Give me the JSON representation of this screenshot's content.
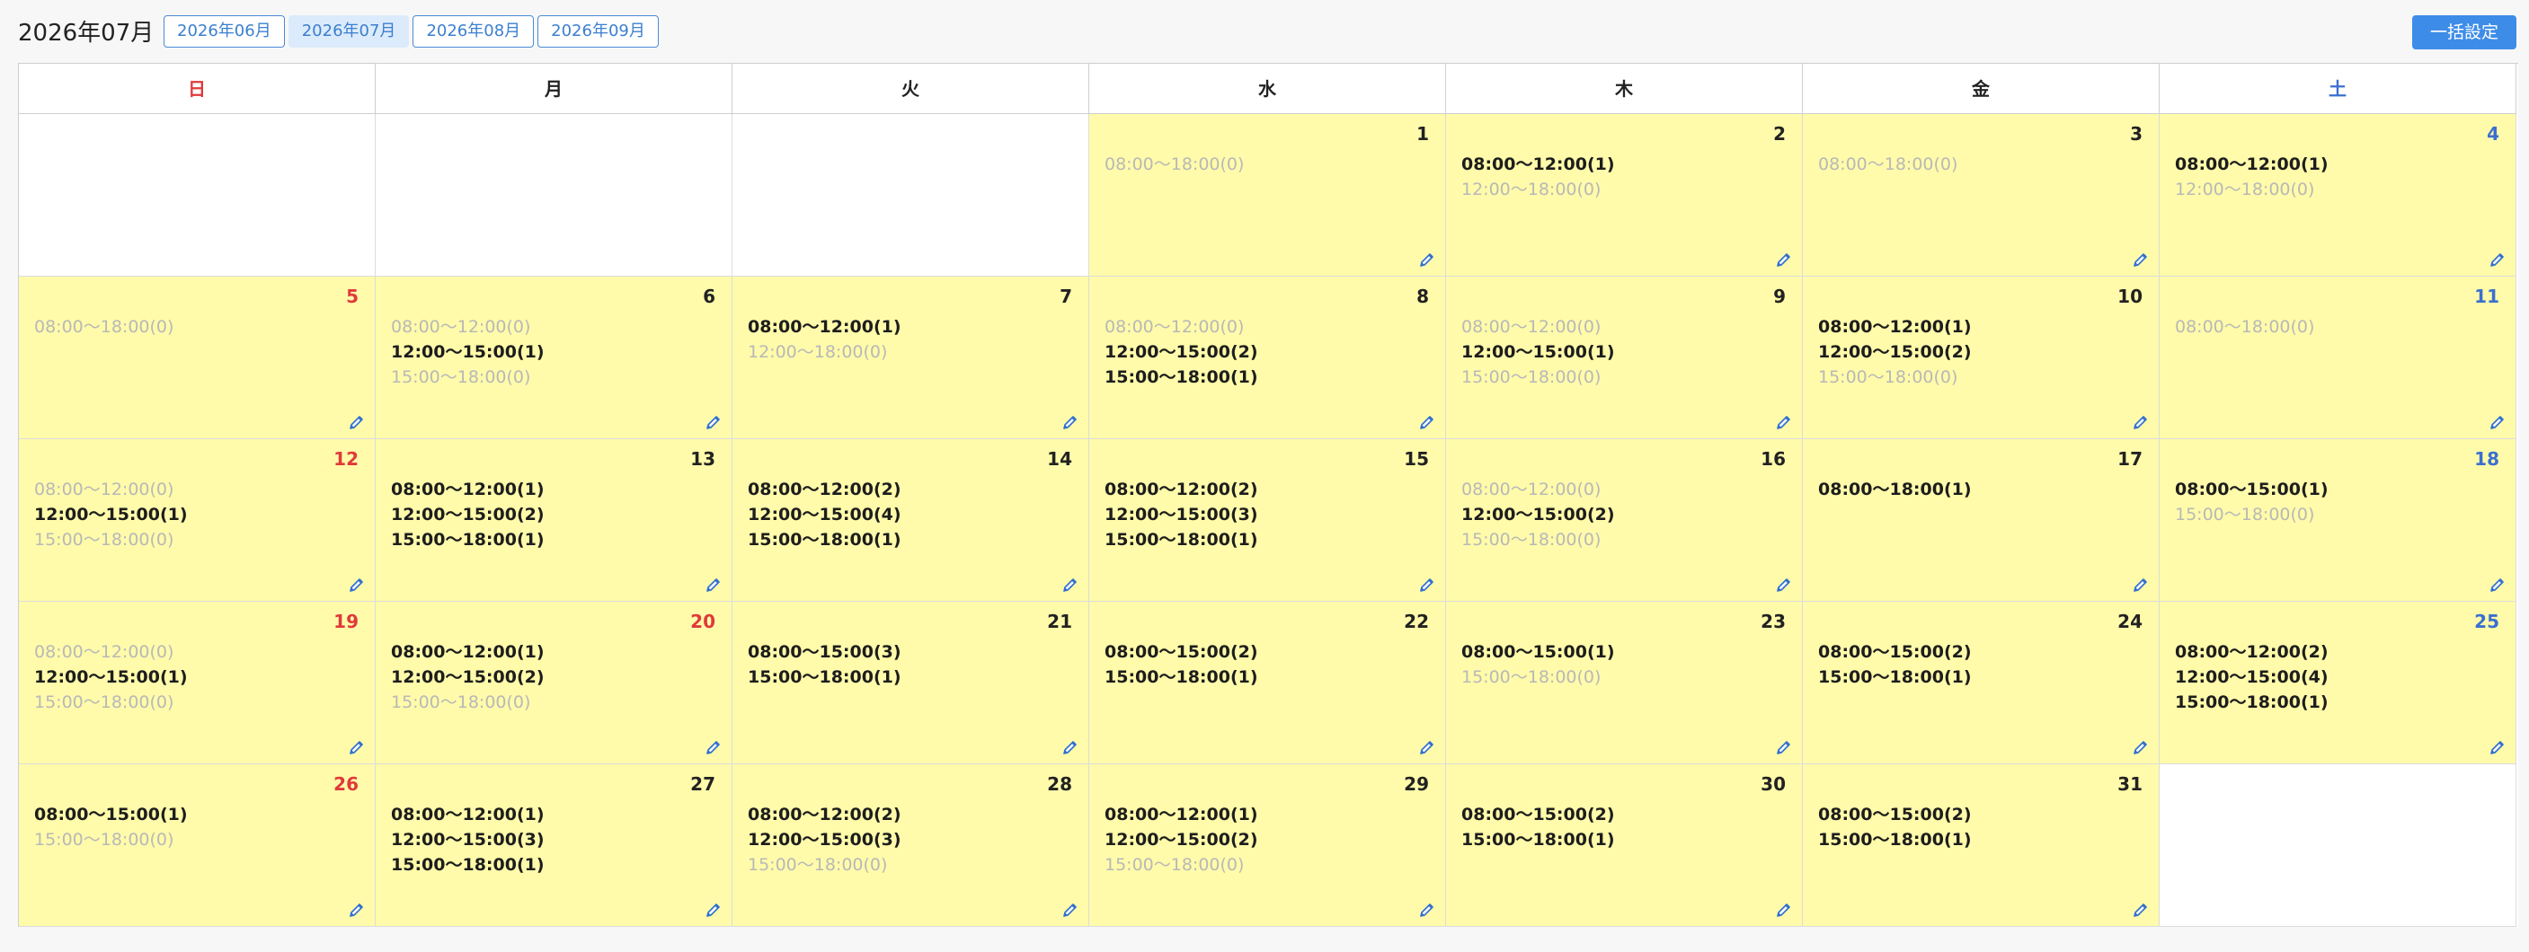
{
  "header": {
    "title": "2026年07月",
    "tabs": [
      {
        "label": "2026年06月",
        "active": false
      },
      {
        "label": "2026年07月",
        "active": true
      },
      {
        "label": "2026年08月",
        "active": false
      },
      {
        "label": "2026年09月",
        "active": false
      }
    ],
    "bulk_button": "一括設定"
  },
  "calendar": {
    "weekdays": [
      "日",
      "月",
      "火",
      "水",
      "木",
      "金",
      "土"
    ],
    "weeks": [
      [
        null,
        null,
        null,
        {
          "day": "1",
          "slots": [
            {
              "text": "08:00〜18:00(0)",
              "booked": false
            }
          ]
        },
        {
          "day": "2",
          "slots": [
            {
              "text": "08:00〜12:00(1)",
              "booked": true
            },
            {
              "text": "12:00〜18:00(0)",
              "booked": false
            }
          ]
        },
        {
          "day": "3",
          "slots": [
            {
              "text": "08:00〜18:00(0)",
              "booked": false
            }
          ]
        },
        {
          "day": "4",
          "slots": [
            {
              "text": "08:00〜12:00(1)",
              "booked": true
            },
            {
              "text": "12:00〜18:00(0)",
              "booked": false
            }
          ]
        }
      ],
      [
        {
          "day": "5",
          "slots": [
            {
              "text": "08:00〜18:00(0)",
              "booked": false
            }
          ]
        },
        {
          "day": "6",
          "slots": [
            {
              "text": "08:00〜12:00(0)",
              "booked": false
            },
            {
              "text": "12:00〜15:00(1)",
              "booked": true
            },
            {
              "text": "15:00〜18:00(0)",
              "booked": false
            }
          ]
        },
        {
          "day": "7",
          "slots": [
            {
              "text": "08:00〜12:00(1)",
              "booked": true
            },
            {
              "text": "12:00〜18:00(0)",
              "booked": false
            }
          ]
        },
        {
          "day": "8",
          "slots": [
            {
              "text": "08:00〜12:00(0)",
              "booked": false
            },
            {
              "text": "12:00〜15:00(2)",
              "booked": true
            },
            {
              "text": "15:00〜18:00(1)",
              "booked": true
            }
          ]
        },
        {
          "day": "9",
          "slots": [
            {
              "text": "08:00〜12:00(0)",
              "booked": false
            },
            {
              "text": "12:00〜15:00(1)",
              "booked": true
            },
            {
              "text": "15:00〜18:00(0)",
              "booked": false
            }
          ]
        },
        {
          "day": "10",
          "slots": [
            {
              "text": "08:00〜12:00(1)",
              "booked": true
            },
            {
              "text": "12:00〜15:00(2)",
              "booked": true
            },
            {
              "text": "15:00〜18:00(0)",
              "booked": false
            }
          ]
        },
        {
          "day": "11",
          "slots": [
            {
              "text": "08:00〜18:00(0)",
              "booked": false
            }
          ]
        }
      ],
      [
        {
          "day": "12",
          "slots": [
            {
              "text": "08:00〜12:00(0)",
              "booked": false
            },
            {
              "text": "12:00〜15:00(1)",
              "booked": true
            },
            {
              "text": "15:00〜18:00(0)",
              "booked": false
            }
          ]
        },
        {
          "day": "13",
          "slots": [
            {
              "text": "08:00〜12:00(1)",
              "booked": true
            },
            {
              "text": "12:00〜15:00(2)",
              "booked": true
            },
            {
              "text": "15:00〜18:00(1)",
              "booked": true
            }
          ]
        },
        {
          "day": "14",
          "slots": [
            {
              "text": "08:00〜12:00(2)",
              "booked": true
            },
            {
              "text": "12:00〜15:00(4)",
              "booked": true
            },
            {
              "text": "15:00〜18:00(1)",
              "booked": true
            }
          ]
        },
        {
          "day": "15",
          "slots": [
            {
              "text": "08:00〜12:00(2)",
              "booked": true
            },
            {
              "text": "12:00〜15:00(3)",
              "booked": true
            },
            {
              "text": "15:00〜18:00(1)",
              "booked": true
            }
          ]
        },
        {
          "day": "16",
          "slots": [
            {
              "text": "08:00〜12:00(0)",
              "booked": false
            },
            {
              "text": "12:00〜15:00(2)",
              "booked": true
            },
            {
              "text": "15:00〜18:00(0)",
              "booked": false
            }
          ]
        },
        {
          "day": "17",
          "slots": [
            {
              "text": "08:00〜18:00(1)",
              "booked": true
            }
          ]
        },
        {
          "day": "18",
          "slots": [
            {
              "text": "08:00〜15:00(1)",
              "booked": true
            },
            {
              "text": "15:00〜18:00(0)",
              "booked": false
            }
          ]
        }
      ],
      [
        {
          "day": "19",
          "holiday": true,
          "slots": [
            {
              "text": "08:00〜12:00(0)",
              "booked": false
            },
            {
              "text": "12:00〜15:00(1)",
              "booked": true
            },
            {
              "text": "15:00〜18:00(0)",
              "booked": false
            }
          ]
        },
        {
          "day": "20",
          "holiday": true,
          "slots": [
            {
              "text": "08:00〜12:00(1)",
              "booked": true
            },
            {
              "text": "12:00〜15:00(2)",
              "booked": true
            },
            {
              "text": "15:00〜18:00(0)",
              "booked": false
            }
          ]
        },
        {
          "day": "21",
          "slots": [
            {
              "text": "08:00〜15:00(3)",
              "booked": true
            },
            {
              "text": "15:00〜18:00(1)",
              "booked": true
            }
          ]
        },
        {
          "day": "22",
          "slots": [
            {
              "text": "08:00〜15:00(2)",
              "booked": true
            },
            {
              "text": "15:00〜18:00(1)",
              "booked": true
            }
          ]
        },
        {
          "day": "23",
          "slots": [
            {
              "text": "08:00〜15:00(1)",
              "booked": true
            },
            {
              "text": "15:00〜18:00(0)",
              "booked": false
            }
          ]
        },
        {
          "day": "24",
          "slots": [
            {
              "text": "08:00〜15:00(2)",
              "booked": true
            },
            {
              "text": "15:00〜18:00(1)",
              "booked": true
            }
          ]
        },
        {
          "day": "25",
          "slots": [
            {
              "text": "08:00〜12:00(2)",
              "booked": true
            },
            {
              "text": "12:00〜15:00(4)",
              "booked": true
            },
            {
              "text": "15:00〜18:00(1)",
              "booked": true
            }
          ]
        }
      ],
      [
        {
          "day": "26",
          "slots": [
            {
              "text": "08:00〜15:00(1)",
              "booked": true
            },
            {
              "text": "15:00〜18:00(0)",
              "booked": false
            }
          ]
        },
        {
          "day": "27",
          "slots": [
            {
              "text": "08:00〜12:00(1)",
              "booked": true
            },
            {
              "text": "12:00〜15:00(3)",
              "booked": true
            },
            {
              "text": "15:00〜18:00(1)",
              "booked": true
            }
          ]
        },
        {
          "day": "28",
          "slots": [
            {
              "text": "08:00〜12:00(2)",
              "booked": true
            },
            {
              "text": "12:00〜15:00(3)",
              "booked": true
            },
            {
              "text": "15:00〜18:00(0)",
              "booked": false
            }
          ]
        },
        {
          "day": "29",
          "slots": [
            {
              "text": "08:00〜12:00(1)",
              "booked": true
            },
            {
              "text": "12:00〜15:00(2)",
              "booked": true
            },
            {
              "text": "15:00〜18:00(0)",
              "booked": false
            }
          ]
        },
        {
          "day": "30",
          "slots": [
            {
              "text": "08:00〜15:00(2)",
              "booked": true
            },
            {
              "text": "15:00〜18:00(1)",
              "booked": true
            }
          ]
        },
        {
          "day": "31",
          "slots": [
            {
              "text": "08:00〜15:00(2)",
              "booked": true
            },
            {
              "text": "15:00〜18:00(1)",
              "booked": true
            }
          ]
        },
        null
      ]
    ]
  },
  "colors": {
    "in_month_bg": "#fffbaa",
    "sunday": "#e03a3a",
    "saturday": "#3b6fd0",
    "accent": "#3d8ce8"
  },
  "icons": {
    "edit": "pencil-icon"
  }
}
